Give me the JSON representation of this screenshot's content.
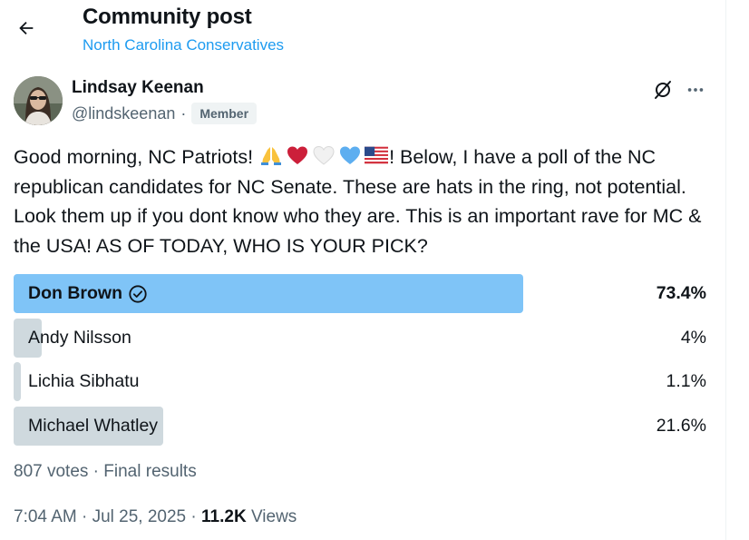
{
  "header": {
    "title": "Community post",
    "community": "North Carolina Conservatives"
  },
  "author": {
    "name": "Lindsay Keenan",
    "handle": "@lindskeenan",
    "separator": "·",
    "badge": "Member"
  },
  "post": {
    "text_before": "Good morning, NC Patriots! ",
    "emojis": [
      "folded-hands",
      "red-heart",
      "white-heart",
      "blue-heart",
      "us-flag"
    ],
    "text_after": "! Below, I have a poll of the NC republican candidates for NC Senate. These are hats in the ring, not potential. Look them up if you dont know who they are. This is an important rave for MC & the USA! AS OF TODAY, WHO IS YOUR PICK?"
  },
  "poll": {
    "options": [
      {
        "label": "Don Brown",
        "percent_text": "73.4%",
        "percent": 73.4,
        "winner": true
      },
      {
        "label": "Andy Nilsson",
        "percent_text": "4%",
        "percent": 4,
        "winner": false
      },
      {
        "label": "Lichia Sibhatu",
        "percent_text": "1.1%",
        "percent": 1.1,
        "winner": false
      },
      {
        "label": "Michael Whatley",
        "percent_text": "21.6%",
        "percent": 21.6,
        "winner": false
      }
    ],
    "summary": "807 votes · Final results"
  },
  "meta": {
    "time": "7:04 AM · Jul 25, 2025 · ",
    "views_count": "11.2K",
    "views_label": " Views"
  },
  "colors": {
    "accent": "#1d9bf0",
    "winner_bar": "#7fc4f7",
    "other_bar": "#cfd9de",
    "secondary_text": "#536471"
  }
}
